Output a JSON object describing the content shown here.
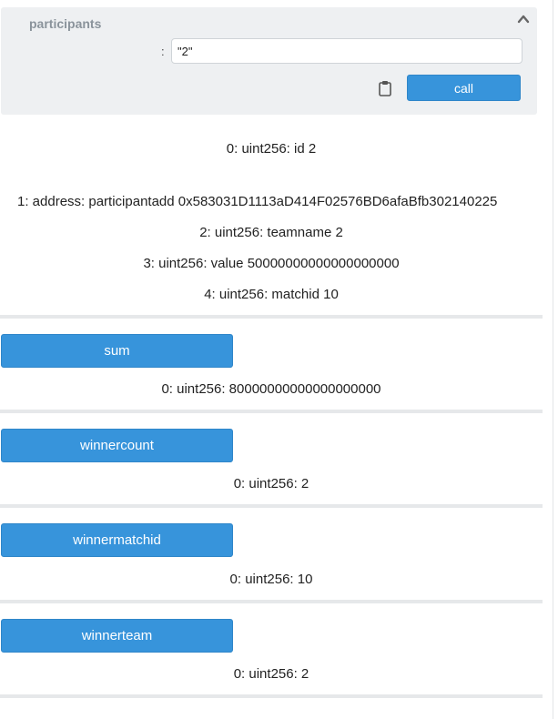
{
  "participants_panel": {
    "title": "participants",
    "param_colon": ":",
    "param_value": "\"2\"",
    "call_label": "call"
  },
  "participants_output": [
    "0: uint256: id 2",
    "1: address: participantadd 0x583031D1113aD414F02576BD6afaBfb302140225",
    "2: uint256: teamname 2",
    "3: uint256: value 50000000000000000000",
    "4: uint256: matchid 10"
  ],
  "functions": [
    {
      "label": "sum",
      "output": "0: uint256: 80000000000000000000"
    },
    {
      "label": "winnercount",
      "output": "0: uint256: 2"
    },
    {
      "label": "winnermatchid",
      "output": "0: uint256: 10"
    },
    {
      "label": "winnerteam",
      "output": "0: uint256: 2"
    }
  ],
  "colors": {
    "button_blue": "#3794db",
    "panel_bg": "#eef0f2",
    "divider": "#e6e8ea"
  },
  "icons": [
    "chevron-up-icon",
    "clipboard-icon"
  ]
}
